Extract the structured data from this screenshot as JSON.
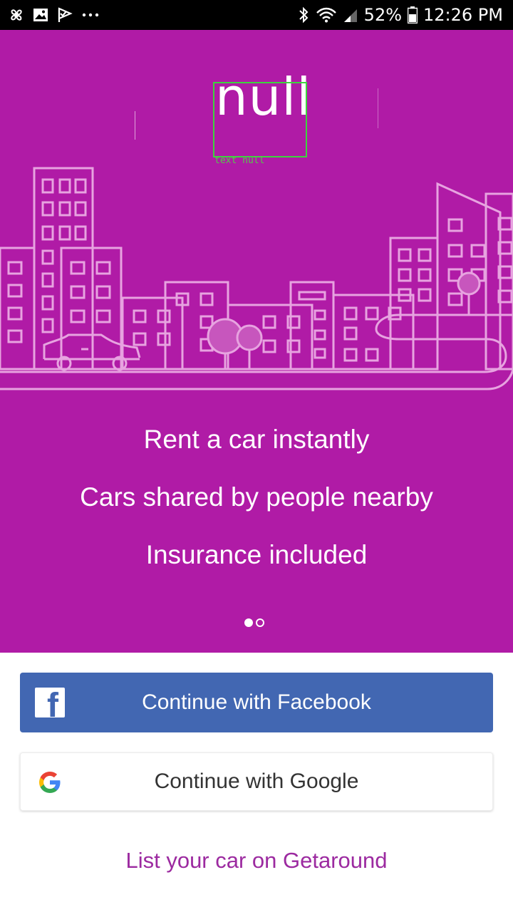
{
  "status_bar": {
    "battery_percent": "52%",
    "time": "12:26 PM",
    "icons": [
      "fan-icon",
      "image-icon",
      "check-flag-icon",
      "more-dots-icon",
      "bluetooth-icon",
      "wifi-icon",
      "signal-icon",
      "battery-icon"
    ]
  },
  "hero": {
    "logo_text": "null",
    "logo_debug_label": "text null",
    "illustration": "city-skyline-illustration",
    "taglines": [
      "Rent a car instantly",
      "Cars shared by people nearby",
      "Insurance included"
    ],
    "pager": {
      "total": 2,
      "current": 1
    }
  },
  "actions": {
    "facebook_label": "Continue with Facebook",
    "google_label": "Continue with Google",
    "list_car_label": "List your car on Getaround"
  },
  "colors": {
    "hero_bg": "#b01ba6",
    "facebook_blue": "#4267b2",
    "link_purple": "#9c2aa0",
    "debug_green": "#3ed43e"
  }
}
